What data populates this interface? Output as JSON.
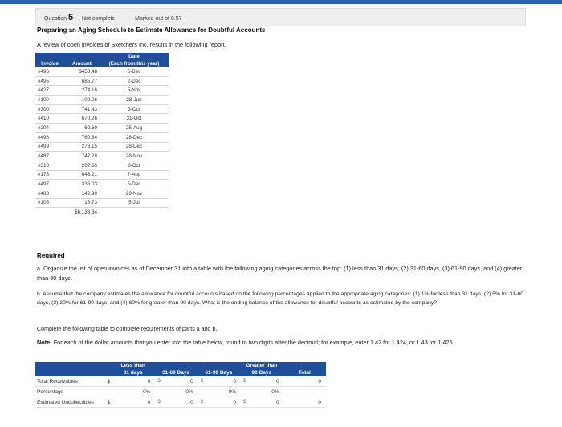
{
  "header": {
    "question_prefix": "Question",
    "question_number": "5",
    "status": "Not complete",
    "marks": "Marked out of 0.57"
  },
  "title": "Preparing an Aging Schedule to Estimate Allowance for Doubtful Accounts",
  "intro": "A review of open invoices of Sketchers Inc. results in the following report.",
  "invoice_table": {
    "header_date_top": "Date",
    "col_invoice": "Invoice",
    "col_amount": "Amount",
    "col_date": "(Each from this year)",
    "rows": [
      {
        "invoice": "#496",
        "amount": "$458.48",
        "date": "5-Dec"
      },
      {
        "invoice": "#495",
        "amount": "685.77",
        "date": "2-Dec"
      },
      {
        "invoice": "#427",
        "amount": "274.16",
        "date": "5-Nov"
      },
      {
        "invoice": "#100",
        "amount": "109.06",
        "date": "28-Jun"
      },
      {
        "invoice": "#300",
        "amount": "741.43",
        "date": "3-Oct"
      },
      {
        "invoice": "#410",
        "amount": "670.26",
        "date": "31-Oct"
      },
      {
        "invoice": "#204",
        "amount": "62.69",
        "date": "25-Aug"
      },
      {
        "invoice": "#498",
        "amount": "760.84",
        "date": "28-Dec"
      },
      {
        "invoice": "#499",
        "amount": "276.15",
        "date": "28-Dec"
      },
      {
        "invoice": "#487",
        "amount": "747.28",
        "date": "28-Nov"
      },
      {
        "invoice": "#310",
        "amount": "207.65",
        "date": "8-Oct"
      },
      {
        "invoice": "#178",
        "amount": "643.21",
        "date": "7-Aug"
      },
      {
        "invoice": "#497",
        "amount": "335.03",
        "date": "5-Dec"
      },
      {
        "invoice": "#488",
        "amount": "142.90",
        "date": "29-Nov"
      },
      {
        "invoice": "#105",
        "amount": "18.73",
        "date": "5-Jul"
      }
    ],
    "total": "$6,133.64"
  },
  "required_label": "Required",
  "part_a": "a. Organize the list of open invoices as of December 31 into a table with the following aging categories across the top: (1) less than 31 days, (2) 31-60 days, (3) 61-90 days, and (4) greater than 90 days.",
  "part_b": "b. Assume that the company estimates the allowance for doubtful accounts based on the following percentages applied to the appropriate aging categories: (1) 1% for less than 31 days, (2) 5% for 31-60 days, (3) 30% for 61-90 days, and (4) 60% for greater than 90 days. What is the ending balance of the allowance for doubtful accounts as estimated by the company?",
  "complete_instruction": "Complete the following table to complete requirements of parts a and b.",
  "note_label": "Note:",
  "note_text": "For each of the dollar amounts that you enter into the table below, round to two digits after the decimal; for example, enter 1.42 for 1.424, or 1.43 for 1.425.",
  "aging_table": {
    "headers": {
      "less_than": "Less than",
      "less_than_2": "31 days",
      "c31_60": "31-60 Days",
      "c61_90": "61-90 Days",
      "greater": "Greater than",
      "greater_2": "90 Days",
      "total": "Total"
    },
    "rows": {
      "total_receivables": {
        "label": "Total Receivables",
        "currency": "$",
        "values": [
          "0",
          "0",
          "0",
          "0"
        ],
        "total": "0"
      },
      "percentage": {
        "label": "Percentage",
        "values": [
          "0%",
          "0%",
          "0%",
          "0%"
        ]
      },
      "estimated_uncollectibles": {
        "label": "Estimated Uncollectibles",
        "currency": "$",
        "values": [
          "0",
          "0",
          "0",
          "0"
        ],
        "total": "0"
      }
    }
  },
  "colors": {
    "accent": "#1e4f98",
    "topbar": "#2f5fb0"
  }
}
